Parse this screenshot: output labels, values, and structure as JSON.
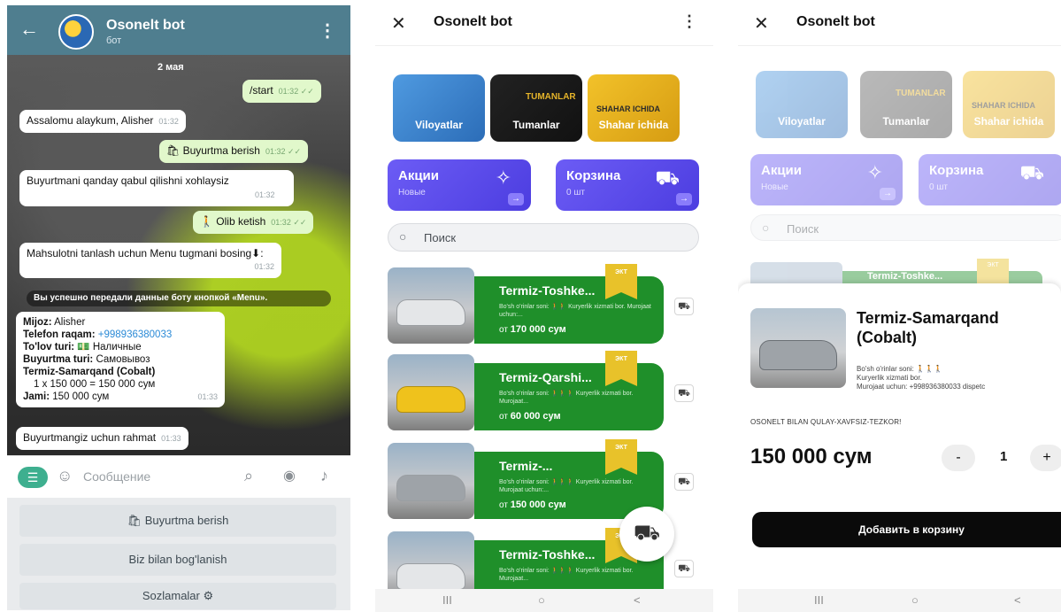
{
  "chat": {
    "back": "←",
    "title": "Osonelt bot",
    "subtitle": "бот",
    "more": "⋮",
    "date": "2 мая",
    "messages": [
      {
        "text": "/start",
        "time": "01:32 ✓✓"
      },
      {
        "text": "Assalomu alaykum, Alisher",
        "time": "01:32"
      },
      {
        "text": "🛍 Buyurtma berish",
        "time": "01:32 ✓✓"
      },
      {
        "text": "Buyurtmani qanday qabul qilishni xohlaysiz",
        "time": "01:32"
      },
      {
        "text": "🚶 Olib ketish",
        "time": "01:32 ✓✓"
      },
      {
        "text": "Mahsulotni tanlash uchun Menu tugmani bosing⬇:",
        "time": "01:32"
      }
    ],
    "system_note": "Вы успешно передали данные боту кнопкой «Menu».",
    "order": {
      "mijoz_label": "Mijoz:",
      "mijoz_value": "Alisher",
      "telefon_label": "Telefon raqam:",
      "telefon_value": "+998936380033",
      "tolov_label": "To'lov turi:",
      "tolov_value": "💵 Наличные",
      "buyurtma_label": "Buyurtma turi:",
      "buyurtma_value": "Самовывоз",
      "item_name": "Termiz-Samarqand (Cobalt)",
      "item_line": "1 x 150 000 = 150 000 сум",
      "jami_label": "Jami:",
      "jami_value": "150 000 сум",
      "time": "01:33"
    },
    "thanks": {
      "text": "Buyurtmangiz uchun rahmat",
      "time": "01:33"
    },
    "input_placeholder": "Сообщение",
    "keyboard": [
      "🛍 Buyurtma berish",
      "Biz bilan bog'lanish",
      "Sozlamalar ⚙"
    ]
  },
  "miniapp": {
    "close": "✕",
    "title": "Osonelt bot",
    "more": "⋮",
    "categories": [
      "Viloyatlar",
      "Tumanlar",
      "Shahar ichida"
    ],
    "category_art": {
      "tumanlar": "TUMANLAR",
      "shahar": "SHAHAR ICHIDA"
    },
    "promo": {
      "title": "Акции",
      "sub": "Новые"
    },
    "cart": {
      "title": "Корзина",
      "sub": "0 шт"
    },
    "search_placeholder": "Поиск",
    "badge": "ЭКТ",
    "products": [
      {
        "name": "Termiz-Toshke...",
        "desc": "Bo'sh o'rinlar soni: 🚶🚶 Kuryerlik xizmati bor. Murojaat uchun:...",
        "price_prefix": "от",
        "price": "170 000 сум"
      },
      {
        "name": "Termiz-Qarshi...",
        "desc": "Bo'sh o'rinlar soni: 🚶🚶🚶 Kuryerlik xizmati bor. Murojaat...",
        "price_prefix": "от",
        "price": "60 000 сум"
      },
      {
        "name": "Termiz-...",
        "desc": "Bo'sh o'rinlar soni: 🚶🚶🚶 Kuryerlik xizmati bor. Murojaat uchun:...",
        "price_prefix": "от",
        "price": "150 000 сум"
      },
      {
        "name": "Termiz-Toshke...",
        "desc": "Bo'sh o'rinlar soni: 🚶🚶🚶 Kuryerlik xizmati bor. Murojaat...",
        "price_prefix": "",
        "price": ""
      }
    ],
    "nav": [
      "III",
      "○",
      "<"
    ]
  },
  "product_sheet": {
    "close": "✕",
    "title": "Osonelt bot",
    "sliver_name": "Termiz-Toshke...",
    "name": "Termiz-Samarqand (Cobalt)",
    "desc_line1": "Bo'sh o'rinlar soni: 🚶🚶🚶",
    "desc_line2": "Kuryerlik xizmati bor.",
    "desc_line3": "Murojaat uchun: +998936380033 dispetc",
    "slogan": "OSONELT BILAN QULAY-XAVFSIZ-TEZKOR!",
    "price": "150 000 сум",
    "qty": "1",
    "minus": "-",
    "plus": "+",
    "add_button": "Добавить в корзину",
    "nav": [
      "III",
      "○",
      "<"
    ]
  },
  "colors": {
    "telegram_header": "#4f7e8f",
    "promo": "#5a4cec",
    "product_card": "#1f8f2a",
    "badge": "#e8c22a"
  }
}
